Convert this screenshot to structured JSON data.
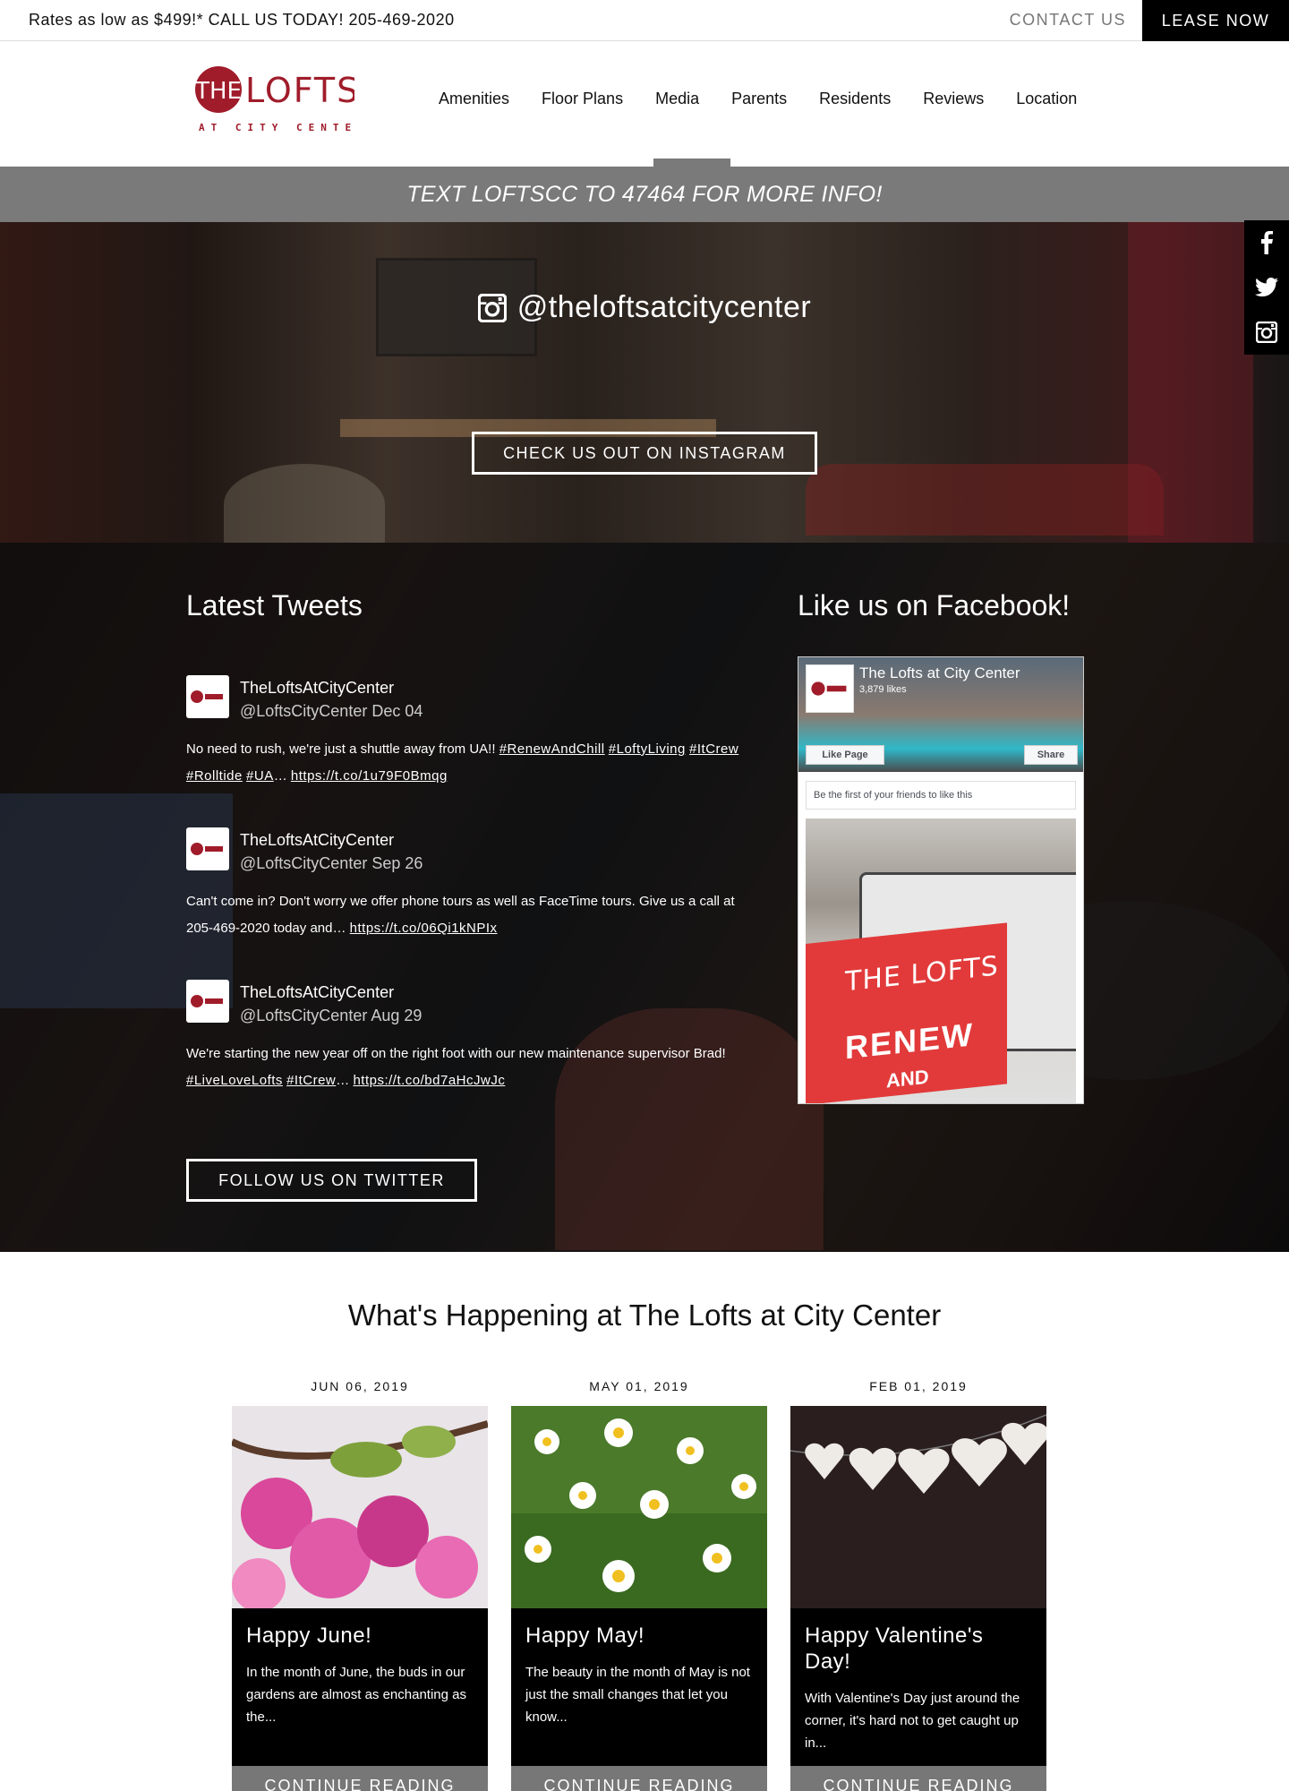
{
  "topbar": {
    "promo": "Rates as low as $499!* CALL US TODAY! 205-469-2020",
    "contact": "CONTACT US",
    "lease": "LEASE NOW"
  },
  "logo": {
    "the": "THE",
    "lofts": "LOFTS",
    "sub": "AT CITY CENTER"
  },
  "nav": [
    "Amenities",
    "Floor Plans",
    "Media",
    "Parents",
    "Residents",
    "Reviews",
    "Location"
  ],
  "banner": "TEXT LOFTSCC TO 47464 FOR MORE INFO!",
  "social": [
    "facebook-icon",
    "twitter-icon",
    "instagram-icon"
  ],
  "instagram": {
    "handle": "@theloftsatcitycenter",
    "button": "CHECK US OUT ON INSTAGRAM"
  },
  "tweets_section": {
    "title": "Latest Tweets",
    "button": "FOLLOW US ON TWITTER",
    "tweets": [
      {
        "name": "TheLoftsAtCityCenter",
        "handle": "@LoftsCityCenter",
        "date": "Dec 04",
        "text": "No need to rush, we're just a shuttle away from UA!!",
        "tags1": "#RenewAndChill",
        "tags2": "#LoftyLiving",
        "tags3": "#ItCrew",
        "tags4": "#Rolltide",
        "tags5": "#UA",
        "ellipsis": "…",
        "link": "https://t.co/1u79F0Bmqg"
      },
      {
        "name": "TheLoftsAtCityCenter",
        "handle": "@LoftsCityCenter",
        "date": "Sep 26",
        "text": "Can't come in? Don't worry we offer phone tours as well as FaceTime tours. Give us a call at 205-469-2020 today and…",
        "link": "https://t.co/06Qi1kNPIx"
      },
      {
        "name": "TheLoftsAtCityCenter",
        "handle": "@LoftsCityCenter",
        "date": "Aug 29",
        "text": "We're starting the new year off on the right foot with our new maintenance supervisor Brad!",
        "tags1": "#LiveLoveLofts",
        "tags2": "#ItCrew",
        "ellipsis": "…",
        "link": "https://t.co/bd7aHcJwJc"
      }
    ]
  },
  "facebook": {
    "title": "Like us on Facebook!",
    "page_name": "The Lofts at City Center",
    "likes": "3,879 likes",
    "like_button": "Like Page",
    "share_button": "Share",
    "friends": "Be the first of your friends to like this",
    "post_sign_1": "THE LOFTS",
    "post_sign_2": "RENEW",
    "post_sign_3": "AND"
  },
  "happening": {
    "title": "What's Happening at The Lofts at City Center",
    "posts": [
      {
        "date": "JUN 06, 2019",
        "title": "Happy June!",
        "excerpt": "In the month of June, the buds in our gardens are almost as enchanting as the...",
        "cta": "CONTINUE READING"
      },
      {
        "date": "MAY 01, 2019",
        "title": "Happy May!",
        "excerpt": "The beauty in the month of May is not just the small changes that let you know...",
        "cta": "CONTINUE READING"
      },
      {
        "date": "FEB 01, 2019",
        "title": "Happy Valentine's Day!",
        "excerpt": "With Valentine's Day just around the corner, it's hard not to get caught up in...",
        "cta": "CONTINUE READING"
      }
    ]
  },
  "colors": {
    "brand_red": "#a01c2a",
    "banner_gray": "#7a7a7a",
    "black": "#000000"
  }
}
